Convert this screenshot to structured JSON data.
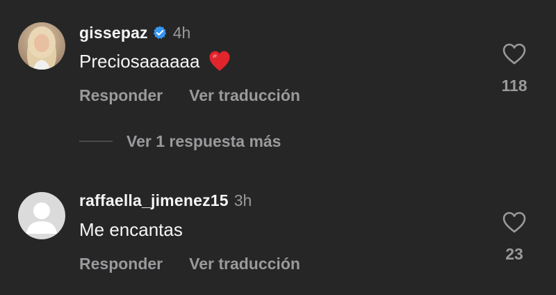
{
  "comments": [
    {
      "username": "gissepaz",
      "verified": true,
      "time": "4h",
      "text": "Preciosaaaaaa",
      "emoji": "red-heart-emoji",
      "reply_label": "Responder",
      "translate_label": "Ver traducción",
      "like_icon": "heart-outline-icon",
      "likes": "118"
    },
    {
      "username": "raffaella_jimenez15",
      "verified": false,
      "time": "3h",
      "text": "Me encantas",
      "reply_label": "Responder",
      "translate_label": "Ver traducción",
      "like_icon": "heart-outline-icon",
      "likes": "23"
    }
  ],
  "more_replies": {
    "label": "Ver 1 respuesta más"
  },
  "colors": {
    "background": "#262627",
    "primary_text": "#f5f5f5",
    "secondary_text": "#9a9a9c",
    "verified_badge": "#3797f0",
    "heart_emoji": "#e0252d"
  }
}
